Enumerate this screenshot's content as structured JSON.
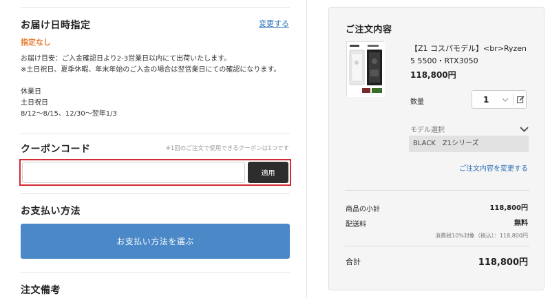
{
  "delivery": {
    "title": "お届け日時指定",
    "change_link": "変更する",
    "value": "指定なし",
    "note_line1": "お届け目安：ご入金確認日より2-3営業日以内にて出荷いたします。",
    "note_line2": "※土日祝日、夏季休暇、年末年始のご入金の場合は翌営業日にての確認になります。",
    "holidays_title": "休業日",
    "holidays_line1": "土日祝日",
    "holidays_line2": "8/12〜8/15、12/30〜翌年1/3"
  },
  "coupon": {
    "title": "クーポンコード",
    "note": "※1回のご注文で使用できるクーポンは1つです",
    "input_value": "",
    "apply_label": "適用"
  },
  "payment": {
    "title": "お支払い方法",
    "button_label": "お支払い方法を選ぶ"
  },
  "order_note": {
    "title": "注文備考"
  },
  "order_summary": {
    "title": "ご注文内容",
    "product_name": "【Z1 コスパモデル】<br>Ryzen 5 5500・RTX3050",
    "product_price": "118,800円",
    "quantity_label": "数量",
    "quantity_value": "1",
    "model_label": "モデル選択",
    "model_value": "BLACK　Z1シリーズ",
    "edit_order_link": "ご注文内容を変更する",
    "subtotal_label": "商品の小計",
    "subtotal_value": "118,800円",
    "shipping_label": "配送料",
    "shipping_value": "無料",
    "tax_note": "消費税10%対象（税込）：118,800円",
    "total_label": "合計",
    "total_value": "118,800円"
  },
  "icons": {
    "chevron": "chevron-down-icon",
    "edit": "pencil-edit-icon",
    "product": "product-thumbnail"
  },
  "colors": {
    "accent_orange": "#e47a2e",
    "link_blue": "#2a6fb8",
    "pay_button": "#4a88c7",
    "apply_button": "#2d2d2d",
    "highlight_border": "#d32a35"
  }
}
